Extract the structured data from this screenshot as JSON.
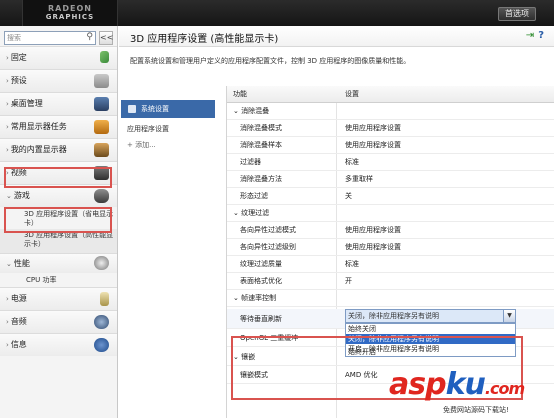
{
  "topbar": {
    "logo_line1": "RADEON",
    "logo_line2": "GRAPHICS",
    "preferences": "首选项"
  },
  "sidebar": {
    "search_placeholder": "搜索",
    "collapse": "<<",
    "items": [
      {
        "label": "固定",
        "icon": "pin-icon"
      },
      {
        "label": "预设",
        "icon": "preset-icon"
      },
      {
        "label": "桌面管理",
        "icon": "desktop-icon"
      },
      {
        "label": "常用显示器任务",
        "icon": "monitor-tasks-icon"
      },
      {
        "label": "我的内置显示器",
        "icon": "laptop-icon"
      },
      {
        "label": "视频",
        "icon": "video-icon"
      },
      {
        "label": "游戏",
        "icon": "gamepad-icon"
      }
    ],
    "game_subitems": [
      "3D 应用程序设置（省电显示卡）",
      "3D 应用程序设置（高性能显示卡）"
    ],
    "items_after": [
      {
        "label": "性能",
        "icon": "gauge-icon"
      }
    ],
    "perf_subitems": [
      "CPU 功率"
    ],
    "items_tail": [
      {
        "label": "电源",
        "icon": "battery-icon"
      },
      {
        "label": "音频",
        "icon": "speaker-icon"
      },
      {
        "label": "信息",
        "icon": "info-icon"
      }
    ]
  },
  "main": {
    "title": "3D 应用程序设置 (高性能显示卡)",
    "description": "配置系统设置和管理用户定义的应用程序配置文件，控制 3D 应用程序的图像质量和性能。",
    "tabs": {
      "active": "系统设置",
      "second": "应用程序设置",
      "add": "+ 添加..."
    },
    "table": {
      "col_feature": "功能",
      "col_setting": "设置",
      "rows": [
        {
          "type": "group",
          "label": "消除混叠"
        },
        {
          "type": "row",
          "label": "消除混叠模式",
          "value": "使用应用程序设置"
        },
        {
          "type": "row",
          "label": "消除混叠样本",
          "value": "使用应用程序设置"
        },
        {
          "type": "row",
          "label": "过滤器",
          "value": "标准"
        },
        {
          "type": "row",
          "label": "消除混叠方法",
          "value": "多重取样"
        },
        {
          "type": "row",
          "label": "形态过滤",
          "value": "关"
        },
        {
          "type": "group",
          "label": "纹理过滤"
        },
        {
          "type": "row",
          "label": "各向异性过滤模式",
          "value": "使用应用程序设置"
        },
        {
          "type": "row",
          "label": "各向异性过滤级别",
          "value": "使用应用程序设置"
        },
        {
          "type": "row",
          "label": "纹理过滤质量",
          "value": "标准"
        },
        {
          "type": "row",
          "label": "表面格式优化",
          "value": "开"
        },
        {
          "type": "group",
          "label": "帧速率控制"
        }
      ],
      "vsync_label": "等待垂直刷新",
      "vsync_value": "关闭，除非应用程序另有说明",
      "vsync_options": [
        "始终关闭",
        "关闭，除非应用程序另有说明",
        "开启，除非应用程序另有说明",
        "始终开启"
      ],
      "opengl_label": "OpenGL 三重缓冲",
      "tess_group": "镶嵌",
      "tess_label": "镶嵌模式",
      "tess_value": "AMD 优化"
    }
  },
  "watermark": {
    "text_a": "asp",
    "text_b": "ku",
    "text_c": ".com",
    "sub": "免费网站源码下载站!"
  }
}
